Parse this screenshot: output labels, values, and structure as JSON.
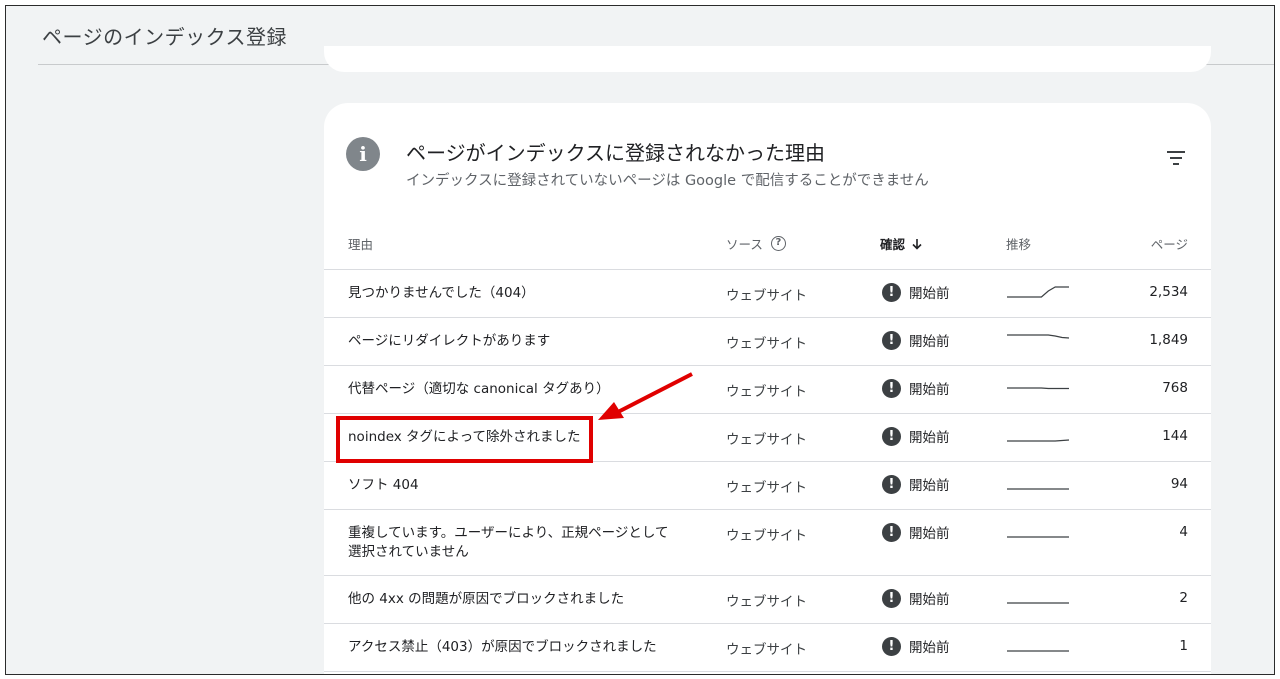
{
  "page": {
    "title": "ページのインデックス登録"
  },
  "card": {
    "title": "ページがインデックスに登録されなかった理由",
    "subtitle": "インデックスに登録されていないページは Google で配信することができません",
    "info_icon": "info-icon",
    "filter_icon": "filter-icon"
  },
  "table": {
    "headers": {
      "reason": "理由",
      "source": "ソース",
      "status": "確認",
      "trend": "推移",
      "pages": "ページ"
    },
    "rows": [
      {
        "reason": "見つかりませんでした（404）",
        "source": "ウェブサイト",
        "status": "開始前",
        "pages": "2,534",
        "trend": [
          0,
          0,
          0,
          0,
          0,
          0,
          0.6,
          1,
          1,
          1
        ]
      },
      {
        "reason": "ページにリダイレクトがあります",
        "source": "ウェブサイト",
        "status": "開始前",
        "pages": "1,849",
        "trend": [
          1,
          1,
          1,
          1,
          1,
          1,
          1,
          0.9,
          0.75,
          0.7
        ]
      },
      {
        "reason": "代替ページ（適切な canonical タグあり）",
        "source": "ウェブサイト",
        "status": "開始前",
        "pages": "768",
        "trend": [
          0.5,
          0.5,
          0.5,
          0.5,
          0.5,
          0.5,
          0.45,
          0.45,
          0.45,
          0.45
        ]
      },
      {
        "reason": "noindex タグによって除外されました",
        "source": "ウェブサイト",
        "status": "開始前",
        "pages": "144",
        "trend": [
          0,
          0,
          0,
          0,
          0,
          0,
          0,
          0,
          0.05,
          0.1
        ]
      },
      {
        "reason": "ソフト 404",
        "source": "ウェブサイト",
        "status": "開始前",
        "pages": "94",
        "trend": [
          0,
          0,
          0,
          0,
          0,
          0,
          0,
          0,
          0,
          0
        ]
      },
      {
        "reason": "重複しています。ユーザーにより、正規ページとして選択されていません",
        "source": "ウェブサイト",
        "status": "開始前",
        "pages": "4",
        "trend": [
          0,
          0,
          0,
          0,
          0,
          0,
          0,
          0,
          0,
          0
        ]
      },
      {
        "reason": "他の 4xx の問題が原因でブロックされました",
        "source": "ウェブサイト",
        "status": "開始前",
        "pages": "2",
        "trend": [
          0,
          0,
          0,
          0,
          0,
          0,
          0,
          0,
          0,
          0
        ]
      },
      {
        "reason": "アクセス禁止（403）が原因でブロックされました",
        "source": "ウェブサイト",
        "status": "開始前",
        "pages": "1",
        "trend": [
          0,
          0,
          0,
          0,
          0,
          0,
          0,
          0,
          0,
          0
        ]
      }
    ]
  },
  "annotation": {
    "color": "#e00000"
  }
}
